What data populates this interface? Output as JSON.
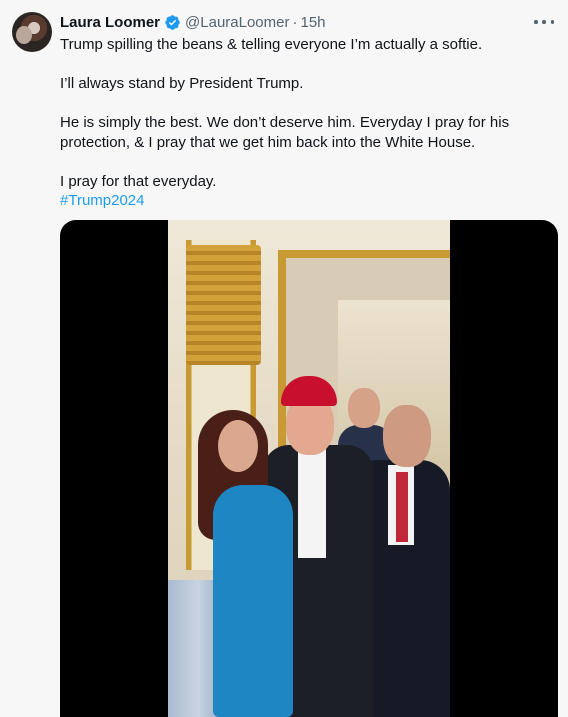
{
  "post": {
    "author_name": "Laura Loomer",
    "handle": "@LauraLoomer",
    "separator": "·",
    "time": "15h",
    "paragraphs": [
      "Trump spilling the beans & telling everyone I’m actually a softie.",
      "I’ll always stand by President Trump.",
      "He is simply the best. We don’t deserve him. Everyday I pray for his protection, & I pray that we get him back into the White House.",
      "I pray for that everyday."
    ],
    "hashtag": "#Trump2024"
  },
  "icons": {
    "verified": "verified-badge-icon",
    "more": "more-options-icon"
  },
  "colors": {
    "link": "#1d9bf0",
    "verified": "#1d9bf0",
    "secondary_text": "#536471"
  }
}
